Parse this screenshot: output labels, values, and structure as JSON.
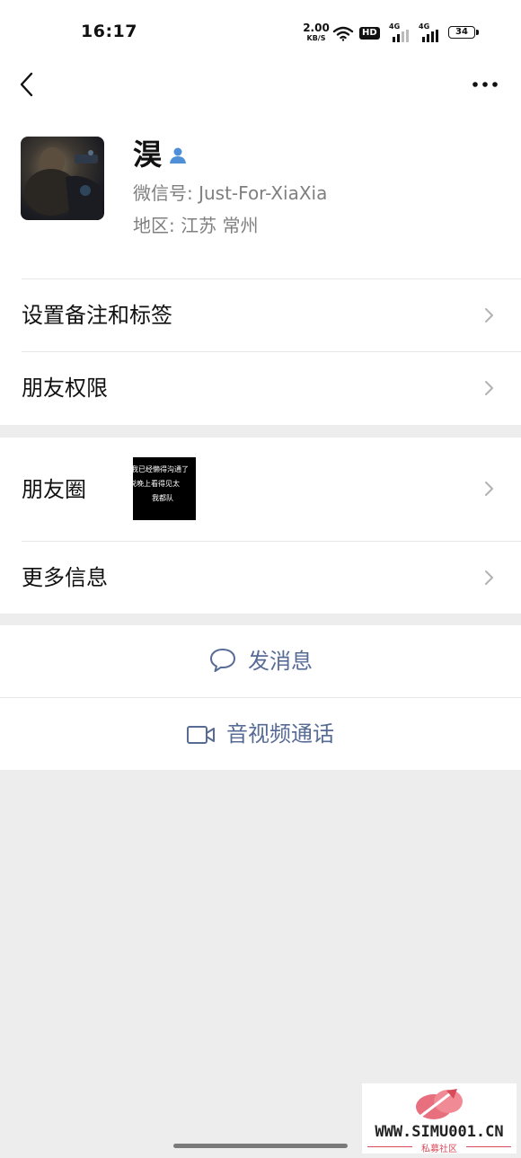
{
  "status_bar": {
    "time": "16:17",
    "net_speed": "2.00",
    "net_unit": "KB/S",
    "hd_label": "HD",
    "signal1_label": "4G",
    "signal2_label": "4G",
    "battery": "34"
  },
  "nav": {
    "back_icon": "chevron-left-icon",
    "more_icon": "more-horizontal-icon"
  },
  "profile": {
    "name": "淏",
    "id_line": "微信号:  Just-For-XiaXia",
    "region_line": "地区:  江苏  常州",
    "badge_icon": "person-icon",
    "badge_color": "#4f8fd8"
  },
  "menu": {
    "remark_tags": "设置备注和标签",
    "friend_permissions": "朋友权限",
    "moments": "朋友圈",
    "more_info": "更多信息"
  },
  "moments_thumb": {
    "line1": "我已经懒得沟通了",
    "line2": "说晚上看得见太",
    "line3": "我都队"
  },
  "actions": {
    "send_message": "发消息",
    "video_call": "音视频通话",
    "accent_color": "#576b95"
  },
  "watermark": {
    "text": "WWW.SIMU001.CN",
    "sub": "私募社区"
  }
}
